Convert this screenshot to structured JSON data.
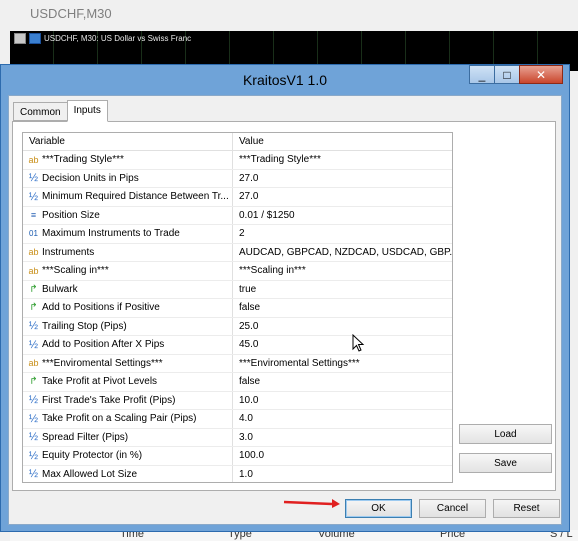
{
  "background": {
    "window_title": "USDCHF,M30",
    "chart_label": "USDCHF, M30:  US Dollar vs Swiss Franc",
    "bottom_columns": [
      "Time",
      "Type",
      "Volume",
      "Price",
      "S / L"
    ]
  },
  "dialog": {
    "title": "KraitosV1 1.0",
    "minimize": "_",
    "maximize": "□",
    "close": "✕",
    "tabs": [
      {
        "label": "Common",
        "active": false
      },
      {
        "label": "Inputs",
        "active": true
      }
    ],
    "grid": {
      "columns": {
        "variable": "Variable",
        "value": "Value"
      },
      "rows": [
        {
          "type": "ab",
          "variable": "***Trading Style***",
          "value": "***Trading Style***"
        },
        {
          "type": "half",
          "variable": "Decision Units in Pips",
          "value": "27.0"
        },
        {
          "type": "half",
          "variable": "Minimum Required Distance Between Tr...",
          "value": "27.0"
        },
        {
          "type": "enum",
          "variable": "Position Size",
          "value": "0.01 / $1250"
        },
        {
          "type": "int",
          "variable": "Maximum Instruments to Trade",
          "value": "2"
        },
        {
          "type": "ab",
          "variable": "Instruments",
          "value": "AUDCAD, GBPCAD, NZDCAD, USDCAD, GBP..."
        },
        {
          "type": "ab",
          "variable": "***Scaling in***",
          "value": "***Scaling in***"
        },
        {
          "type": "bool",
          "variable": "Bulwark",
          "value": "true"
        },
        {
          "type": "bool",
          "variable": "Add to Positions if Positive",
          "value": "false"
        },
        {
          "type": "half",
          "variable": "Trailing Stop (Pips)",
          "value": "25.0"
        },
        {
          "type": "half",
          "variable": "Add to Position After X Pips",
          "value": "45.0"
        },
        {
          "type": "ab",
          "variable": "***Enviromental Settings***",
          "value": "***Enviromental Settings***"
        },
        {
          "type": "bool",
          "variable": "Take Profit at Pivot Levels",
          "value": "false"
        },
        {
          "type": "half",
          "variable": "First Trade's Take Profit (Pips)",
          "value": "10.0"
        },
        {
          "type": "half",
          "variable": "Take Profit on a Scaling Pair (Pips)",
          "value": "4.0"
        },
        {
          "type": "half",
          "variable": "Spread Filter (Pips)",
          "value": "3.0"
        },
        {
          "type": "half",
          "variable": "Equity Protector (in %)",
          "value": "100.0"
        },
        {
          "type": "half",
          "variable": "Max Allowed Lot Size",
          "value": "1.0"
        }
      ]
    },
    "load_label": "Load",
    "save_label": "Save",
    "ok_label": "OK",
    "cancel_label": "Cancel",
    "reset_label": "Reset"
  },
  "icons": {
    "ab": "ab",
    "half": "½",
    "int": "01",
    "bool": "↱",
    "enum": "≡"
  },
  "colors": {
    "dialog_frame": "#6fa3d8",
    "close_button": "#c9462c",
    "arrow": "#e02020"
  }
}
